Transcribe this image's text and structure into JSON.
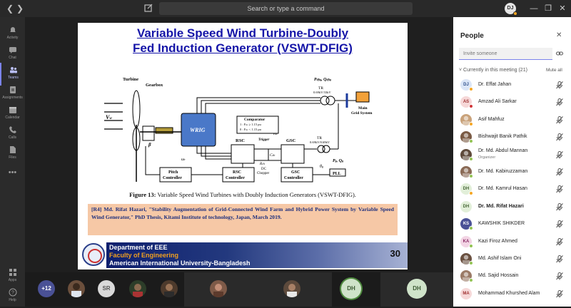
{
  "topbar": {
    "search_placeholder": "Search or type a command",
    "me_initials": "DJ"
  },
  "rail": {
    "items": [
      {
        "label": "Activity",
        "icon": "bell-icon"
      },
      {
        "label": "Chat",
        "icon": "chat-icon"
      },
      {
        "label": "Teams",
        "icon": "teams-icon"
      },
      {
        "label": "Assignments",
        "icon": "assignments-icon"
      },
      {
        "label": "Calendar",
        "icon": "calendar-icon"
      },
      {
        "label": "Calls",
        "icon": "phone-icon"
      },
      {
        "label": "Files",
        "icon": "file-icon"
      },
      {
        "label": "Apps",
        "icon": "apps-icon"
      },
      {
        "label": "Help",
        "icon": "help-icon"
      }
    ]
  },
  "slide": {
    "title_line1": "Variable Speed Wind Turbine-Doubly",
    "title_line2": "Fed Induction Generator (VSWT-DFIG)",
    "diagram": {
      "turbine": "Turbine",
      "gearbox": "Gearbox",
      "wrig": "WRIG",
      "vw": "V",
      "vw_sub": "w",
      "beta": "β",
      "omega": "ω",
      "omega_sub": "r",
      "comparator_title": "Comparator",
      "comparator_l1": "1 : F",
      "comparator_l1b": "dc",
      "comparator_l1c": " ≥ 1.15 pu",
      "comparator_l2": "0 : F",
      "comparator_l2b": "dc",
      "comparator_l2c": " < 1.15 pu",
      "trigger": "Trigger",
      "rsc": "RSC",
      "gsc": "GSC",
      "cdc": "C",
      "cdc_sub": "dc",
      "rch": "R",
      "rch_sub": "ch",
      "dc_chopper": "DC",
      "dc_chopper2": "Chopper",
      "vdc": "V",
      "vdc_sub": "dc",
      "tr_top": "TR",
      "tr_top_rating": "0.69kV/33kV",
      "tr_mid": "TR",
      "tr_mid_rating": "0.69kV/0.69kV",
      "grid": "Main",
      "grid2": "Grid System",
      "pdfig_top": "P",
      "pdfig_top_sub": "dfig",
      "qdfig_top": "Q",
      "qdfig_top_sub": "dfig",
      "pg": "P",
      "pg_sub": "g",
      "qg": "Q",
      "qg_sub": "g",
      "pitch": "Pitch",
      "pitch2": "Controller",
      "rsc_ctrl": "RSC",
      "rsc_ctrl2": "Controller",
      "gsc_ctrl": "GSC",
      "gsc_ctrl2": "Controller",
      "pll": "PLL",
      "theta": "θ",
      "theta_sub": "g",
      "rsc_in_p": "P",
      "rsc_in_p_sub": "dfig",
      "rsc_in_q": "Q",
      "rsc_in_q_sub": "dfig",
      "gsc_in_v": "V",
      "gsc_in_v_sub": "dc",
      "gsc_in_q": "Q",
      "gsc_in_q_sub": "g"
    },
    "caption_bold": "Figure 13:",
    "caption_text": " Variable Speed Wind Turbines with Doubly Induction Generators (VSWT-DFIG).",
    "reference": "[R4] Md. Rifat Hazari, \"Stability Augmentation of Grid-Connected Wind Farm and Hybrid Power System by Variable Speed Wind Generator,\" PhD Thesis, Kitami Institute of technology, Japan, March 2019.",
    "footer_dept": "Department of EEE",
    "footer_faculty": "Faculty of Engineering",
    "footer_university": "American International University-Bangladesh",
    "page_number": "30"
  },
  "strip": {
    "more": "+12",
    "sr": "SR",
    "dh1": "DH",
    "dh2": "DH"
  },
  "panel": {
    "title": "People",
    "invite_placeholder": "Invite someone",
    "section": "Currently in this meeting (21)",
    "mute_all": "Mute all",
    "people": [
      {
        "initials": "DJ",
        "name": "Dr. Effat Jahan",
        "bg": "#dbe6f7",
        "fg": "#2d4f8a",
        "status": "#f5a623"
      },
      {
        "initials": "AS",
        "name": "Amzad Ali Sarkar",
        "bg": "#f6d8d8",
        "fg": "#a03434",
        "status": "#d13438"
      },
      {
        "initials": "",
        "name": "Asif Mahfuz",
        "bg": "#c9a27a",
        "fg": "#fff",
        "status": "#f5a623",
        "photo": true
      },
      {
        "initials": "",
        "name": "Bishwajit Banik Pathik",
        "bg": "#7a5a44",
        "fg": "#fff",
        "status": "#92c353",
        "photo": true
      },
      {
        "initials": "",
        "name": "Dr. Md. Abdul Mannan",
        "sub": "Organizer",
        "bg": "#5e4a3a",
        "fg": "#fff",
        "status": "#92c353",
        "photo": true
      },
      {
        "initials": "",
        "name": "Dr. Md. Kabiruzzaman",
        "bg": "#8a6a55",
        "fg": "#fff",
        "status": "#92c353",
        "photo": true
      },
      {
        "initials": "DH",
        "name": "Dr. Md. Kamrul Hasan",
        "bg": "#e2efd9",
        "fg": "#4a6a3a",
        "status": "#f5a623"
      },
      {
        "initials": "DH",
        "name": "Dr. Md. Rifat Hazari",
        "bg": "#e2efd9",
        "fg": "#4a6a3a",
        "status": "",
        "highlight": true
      },
      {
        "initials": "KS",
        "name": "KAWSHIK SHIKDER",
        "bg": "#4a5196",
        "fg": "#fff",
        "status": "#92c353"
      },
      {
        "initials": "KA",
        "name": "Kazi Firoz Ahmed",
        "bg": "#f3d5e5",
        "fg": "#8a2c66",
        "status": "#92c353"
      },
      {
        "initials": "",
        "name": "Md. Ashif Islam Oni",
        "bg": "#6a5040",
        "fg": "#fff",
        "status": "#92c353",
        "photo": true
      },
      {
        "initials": "",
        "name": "Md. Sajid Hossain",
        "bg": "#9a7a66",
        "fg": "#fff",
        "status": "#92c353",
        "photo": true
      },
      {
        "initials": "MA",
        "name": "Mohammad Khurshed Alam",
        "bg": "#f6d8d8",
        "fg": "#a03434",
        "status": ""
      }
    ]
  }
}
